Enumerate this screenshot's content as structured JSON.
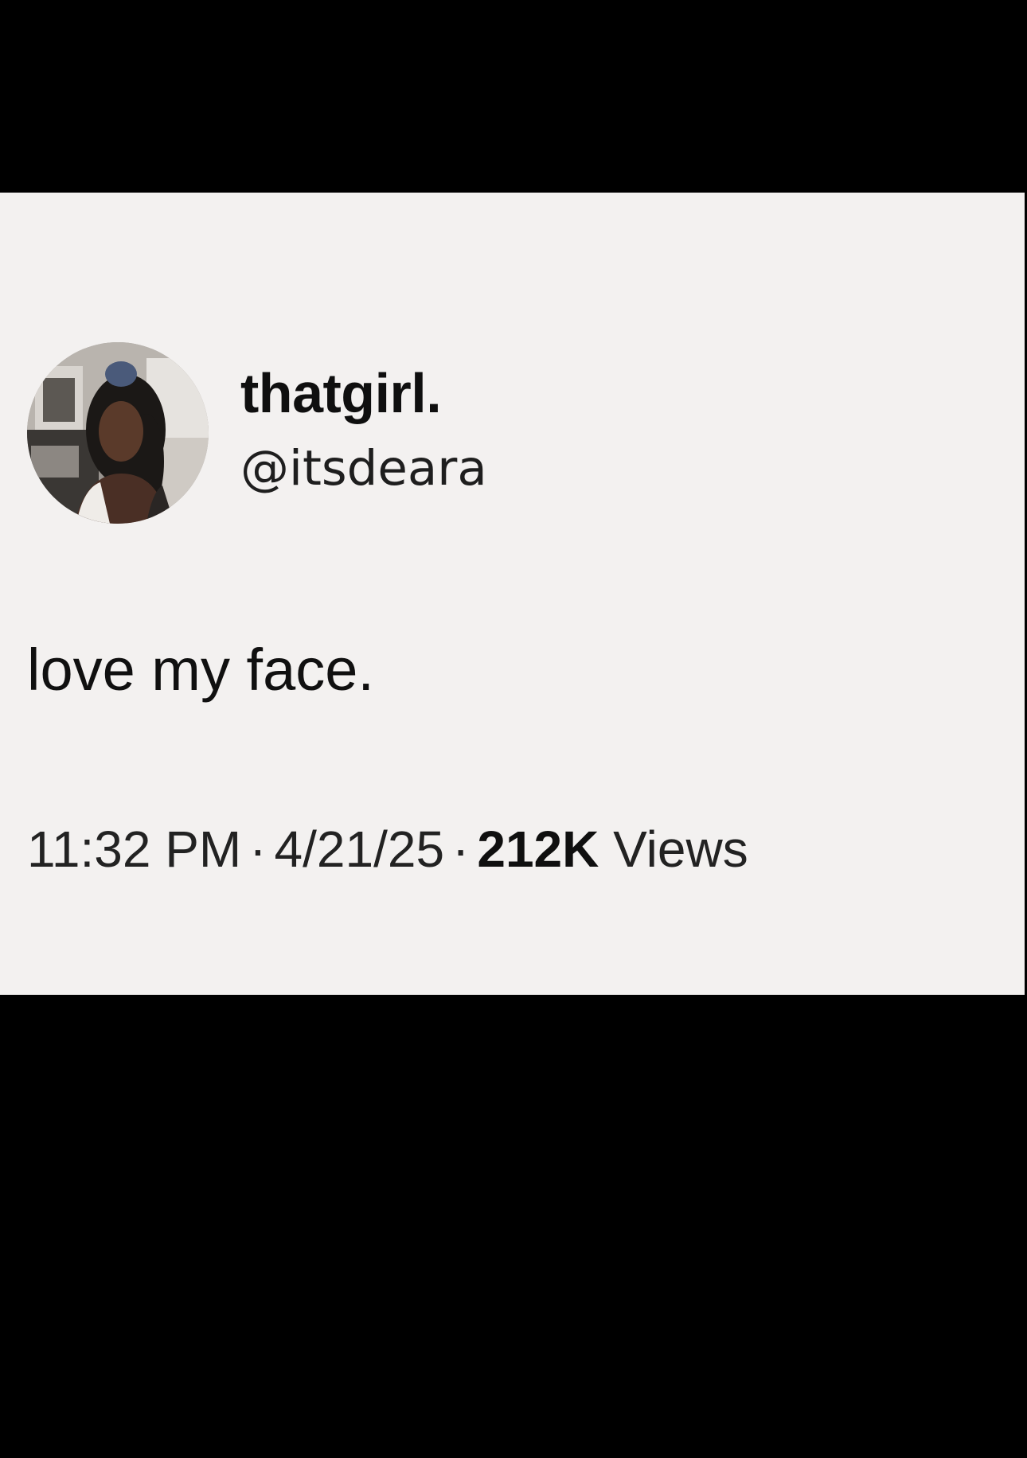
{
  "tweet": {
    "author": {
      "display_name": "thatgirl.",
      "handle": "@itsdeara",
      "avatar_icon": "profile-photo"
    },
    "text": "love my face.",
    "meta": {
      "time": "11:32 PM",
      "date": "4/21/25",
      "separator": "·",
      "views_count": "212K",
      "views_label": "Views"
    }
  },
  "colors": {
    "page_background": "#000000",
    "card_background": "#f3f1f0",
    "text_primary": "#0f0f0f",
    "text_secondary": "#222222"
  }
}
